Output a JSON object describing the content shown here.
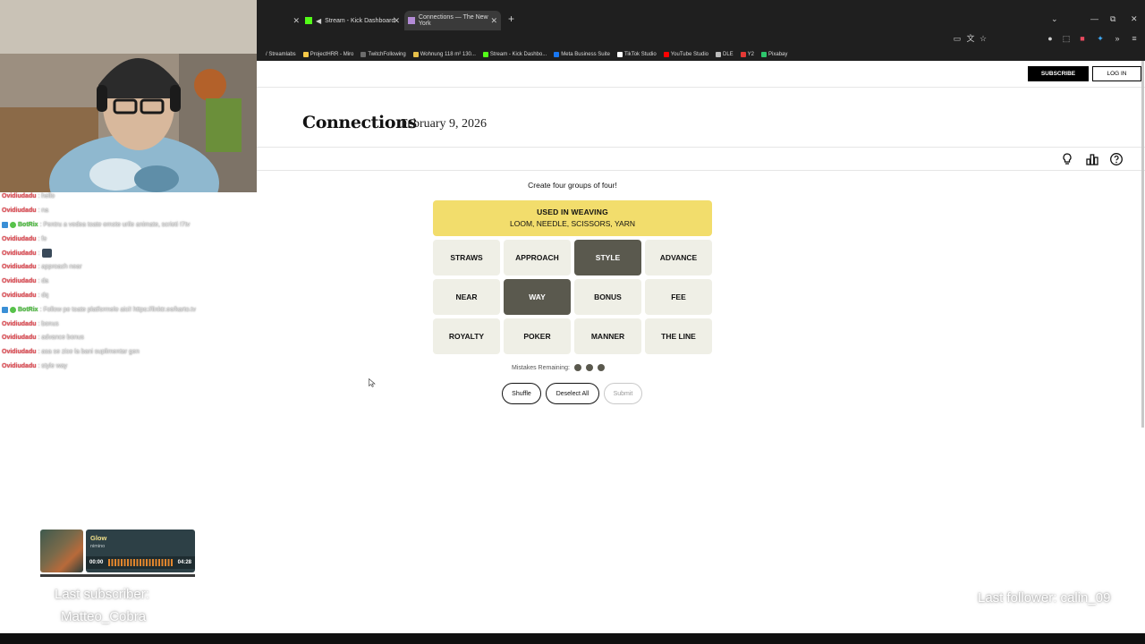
{
  "browser": {
    "tabs": [
      {
        "label": "",
        "active": false
      },
      {
        "label": "Stream - Kick Dashboard",
        "active": false
      },
      {
        "label": "Connections — The New York",
        "active": true
      }
    ],
    "new_tab": "+",
    "bookmarks": [
      {
        "label": "/ Streamlabs",
        "color": "#1f1f1f"
      },
      {
        "label": "ProjectHRR - Miro",
        "color": "#f7c948"
      },
      {
        "label": "TwitchFollowing",
        "color": "#6c6c6c"
      },
      {
        "label": "Wohnung 118 m² 130...",
        "color": "#e7c04a"
      },
      {
        "label": "Stream - Kick Dashbo...",
        "color": "#53fc18"
      },
      {
        "label": "Meta Business Suite",
        "color": "#1877f2"
      },
      {
        "label": "TikTok Studio",
        "color": "#ffffff"
      },
      {
        "label": "YouTube Studio",
        "color": "#ff0000"
      },
      {
        "label": "DLE",
        "color": "#bdbdbd"
      },
      {
        "label": "Y2",
        "color": "#e53935"
      },
      {
        "label": "Pixabay",
        "color": "#2ec66d"
      }
    ]
  },
  "header": {
    "subscribe_label": "SUBSCRIBE",
    "login_label": "LOG IN"
  },
  "game": {
    "title": "Connections",
    "date": "February 9, 2026",
    "instruction": "Create four groups of four!",
    "solved_group": {
      "title": "USED IN WEAVING",
      "words": "LOOM, NEEDLE, SCISSORS, YARN",
      "color": "#f2dd6c"
    },
    "tiles": [
      {
        "label": "STRAWS",
        "selected": false
      },
      {
        "label": "APPROACH",
        "selected": false
      },
      {
        "label": "STYLE",
        "selected": true
      },
      {
        "label": "ADVANCE",
        "selected": false
      },
      {
        "label": "NEAR",
        "selected": false
      },
      {
        "label": "WAY",
        "selected": true
      },
      {
        "label": "BONUS",
        "selected": false
      },
      {
        "label": "FEE",
        "selected": false
      },
      {
        "label": "ROYALTY",
        "selected": false
      },
      {
        "label": "POKER",
        "selected": false
      },
      {
        "label": "MANNER",
        "selected": false
      },
      {
        "label": "THE LINE",
        "selected": false
      }
    ],
    "mistakes_label": "Mistakes Remaining:",
    "mistakes_remaining": 3,
    "buttons": {
      "shuffle": "Shuffle",
      "deselect": "Deselect All",
      "submit": "Submit"
    },
    "tile_color": "#efefe6",
    "selected_color": "#5a594e"
  },
  "chat": {
    "messages": [
      {
        "user": "Ovidiudadu",
        "text": ": hello",
        "bot": false
      },
      {
        "user": "Ovidiudadu",
        "text": ": na",
        "bot": false
      },
      {
        "user": "BotRix",
        "text": ": Pentru a vedea toate emote urile animate, scrieti !7tv",
        "bot": true
      },
      {
        "user": "Ovidiudadu",
        "text": ": fe",
        "bot": false
      },
      {
        "user": "Ovidiudadu",
        "text": ":",
        "bot": false,
        "emote": true
      },
      {
        "user": "Ovidiudadu",
        "text": ": approach near",
        "bot": false
      },
      {
        "user": "Ovidiudadu",
        "text": ": da",
        "bot": false
      },
      {
        "user": "Ovidiudadu",
        "text": ": dq",
        "bot": false
      },
      {
        "user": "BotRix",
        "text": ": Follow pe toate platformele aici! https://linktr.ee/karto.tv",
        "bot": true
      },
      {
        "user": "Ovidiudadu",
        "text": ": bonus",
        "bot": false
      },
      {
        "user": "Ovidiudadu",
        "text": ": advance bonus",
        "bot": false
      },
      {
        "user": "Ovidiudadu",
        "text": ": asa se zice la bani suplimentar gen",
        "bot": false
      },
      {
        "user": "Ovidiudadu",
        "text": ": style way",
        "bot": false
      }
    ]
  },
  "player": {
    "song": "Glow",
    "artist": "nimino",
    "current_time": "00:00",
    "total_time": "04:28",
    "progress": 0.0
  },
  "overlays": {
    "last_subscriber_label": "Last subscriber:",
    "last_subscriber_name": "Matteo_Cobra",
    "last_follower": "Last follower: calin_09"
  }
}
